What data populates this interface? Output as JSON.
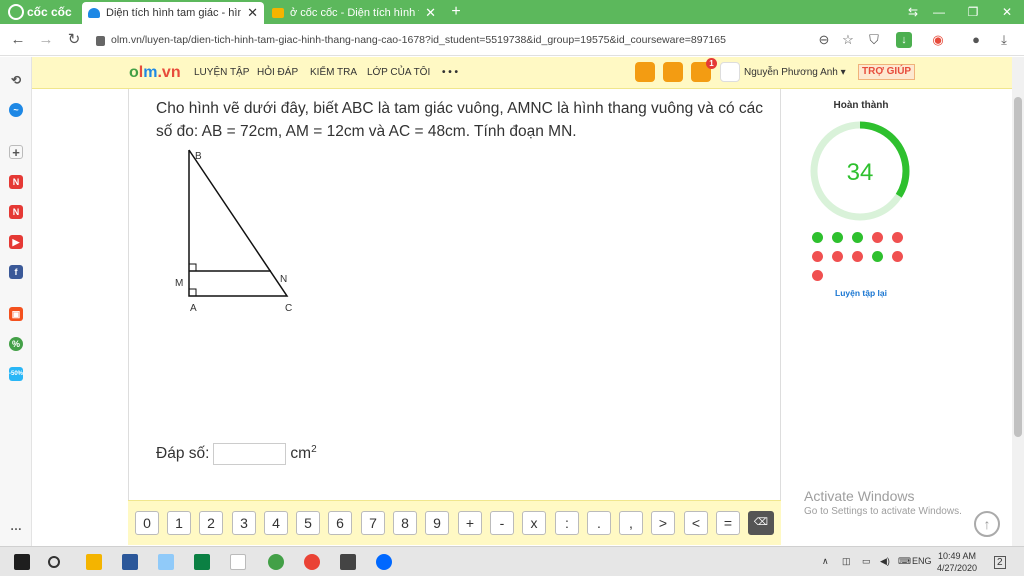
{
  "browser": {
    "brand": "cốc cốc",
    "tabs": [
      {
        "title": "Diện tích hình tam giác - hình",
        "active": true
      },
      {
        "title": "ở cốc cốc - Diện tích hình tam",
        "active": false
      }
    ],
    "url": "olm.vn/luyen-tap/dien-tich-hinh-tam-giac-hinh-thang-nang-cao-1678?id_student=5519738&id_group=19575&id_courseware=897165"
  },
  "site": {
    "logo_o": "o",
    "logo_l": "l",
    "logo_m": "m",
    "logo_tld": ".vn",
    "nav": [
      "LUYỆN TẬP",
      "HỎI ĐÁP",
      "KIỂM TRA",
      "LỚP CỦA TÔI"
    ],
    "more": "• • •",
    "notification_count": "1",
    "user": "Nguyễn Phương Anh",
    "help": "TRỢ GIÚP"
  },
  "question": {
    "text": "Cho hình vẽ dưới đây, biết ABC là tam giác vuông, AMNC là hình thang vuông và có các số đo: AB = 72cm, AM = 12cm và AC = 48cm. Tính đoạn MN.",
    "labels": {
      "B": "B",
      "M": "M",
      "N": "N",
      "A": "A",
      "C": "C"
    },
    "answer_label": "Đáp số:",
    "answer_value": "",
    "answer_unit": "cm",
    "answer_unit_exp": "2"
  },
  "keypad": [
    "0",
    "1",
    "2",
    "3",
    "4",
    "5",
    "6",
    "7",
    "8",
    "9",
    "+",
    "-",
    "x",
    ":",
    ".",
    ",",
    ">",
    "<",
    "="
  ],
  "progress": {
    "title": "Hoàn thành",
    "score": "34",
    "score_fraction": 0.34,
    "colors": {
      "done": "#2ec02e",
      "track": "#d9f2d9",
      "correct": "#2ec02e",
      "wrong": "#f05050"
    },
    "results": [
      "correct",
      "correct",
      "correct",
      "wrong",
      "wrong",
      "wrong",
      "wrong",
      "wrong",
      "correct",
      "wrong",
      "wrong"
    ],
    "retry": "Luyện tập lại"
  },
  "watermark": {
    "line1": "Activate Windows",
    "line2": "Go to Settings to activate Windows."
  },
  "taskbar": {
    "lang": "ENG",
    "time": "10:49 AM",
    "date": "4/27/2020",
    "notifications": "2"
  }
}
